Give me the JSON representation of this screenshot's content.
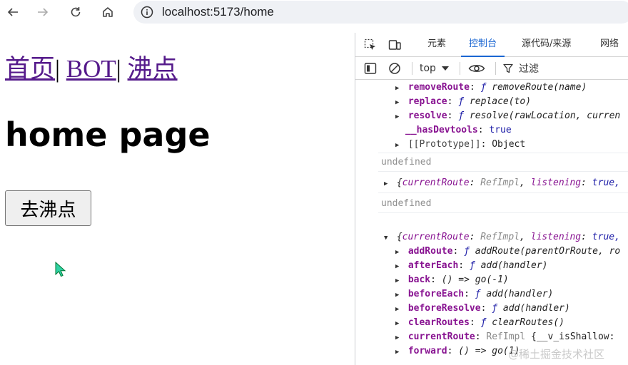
{
  "browser": {
    "url": "localhost:5173/home"
  },
  "page": {
    "links": [
      "首页",
      "BOT",
      "沸点"
    ],
    "separator": "|",
    "title": "home page",
    "button_label": "去沸点"
  },
  "devtools": {
    "tabs": [
      "元素",
      "控制台",
      "源代码/来源",
      "网络"
    ],
    "active_tab": "控制台",
    "context": "top",
    "filter_label": "过滤"
  },
  "console": {
    "router1_props": [
      {
        "key": "removeRoute",
        "f": "ƒ",
        "value": "removeRoute(name)"
      },
      {
        "key": "replace",
        "f": "ƒ",
        "value": "replace(to)"
      },
      {
        "key": "resolve",
        "f": "ƒ",
        "value": "resolve(rawLocation, curren"
      }
    ],
    "has_devtools": {
      "key": "__hasDevtools",
      "value": "true"
    },
    "prototype": {
      "key": "[[Prototype]]",
      "value": "Object"
    },
    "undefined_text": "undefined",
    "object_summary": {
      "open": "{",
      "key1": "currentRoute",
      "val1": "RefImpl",
      "key2": "listening",
      "val2": "true,"
    },
    "router2_props": [
      {
        "key": "addRoute",
        "f": "ƒ",
        "value": "addRoute(parentOrRoute, ro"
      },
      {
        "key": "afterEach",
        "f": "ƒ",
        "value": "add(handler)"
      },
      {
        "key": "back",
        "f": "",
        "value": "() => go(-1)"
      },
      {
        "key": "beforeEach",
        "f": "ƒ",
        "value": "add(handler)"
      },
      {
        "key": "beforeResolve",
        "f": "ƒ",
        "value": "add(handler)"
      },
      {
        "key": "clearRoutes",
        "f": "ƒ",
        "value": "clearRoutes()"
      }
    ],
    "current_route": {
      "key": "currentRoute",
      "value": "RefImpl",
      "extra": "{__v_isShallow:"
    },
    "forward": {
      "key": "forward",
      "value": "() => go(1)"
    }
  },
  "watermark": "@稀土掘金技术社区"
}
